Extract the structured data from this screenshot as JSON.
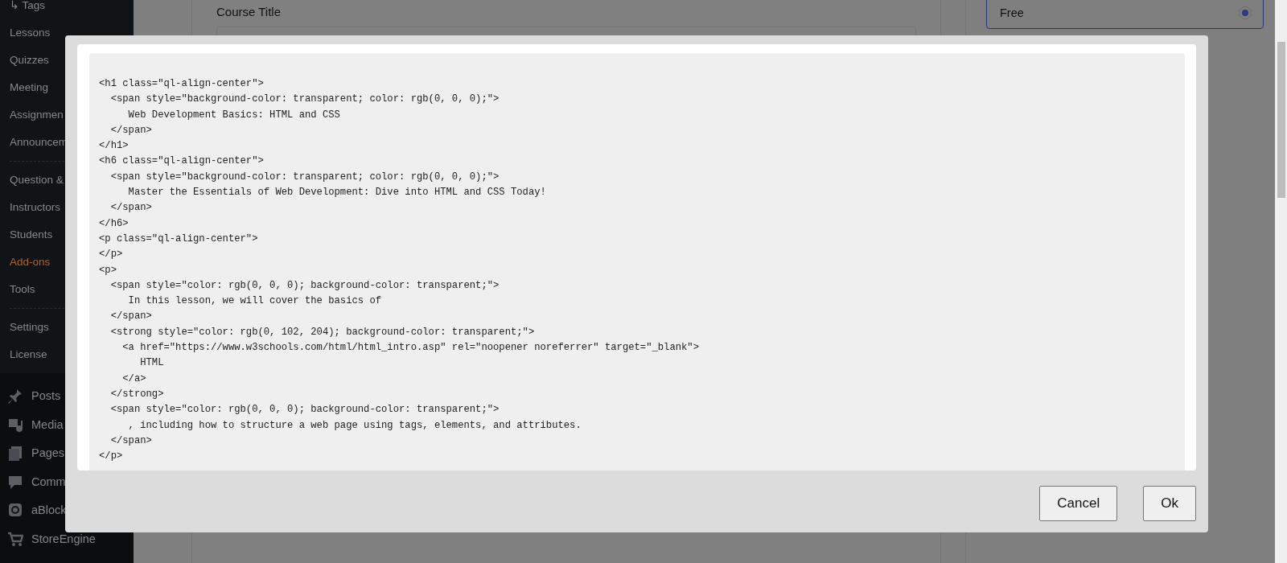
{
  "sidebar": {
    "submenu_groups": [
      [
        {
          "label": "↳ Tags",
          "selected": false
        },
        {
          "label": "Lessons",
          "selected": false
        },
        {
          "label": "Quizzes",
          "selected": false
        },
        {
          "label": "Meeting",
          "selected": false
        },
        {
          "label": "Assignmen",
          "selected": false
        },
        {
          "label": "Announcem",
          "selected": false
        }
      ],
      [
        {
          "label": "Question &",
          "selected": false
        },
        {
          "label": "Instructors",
          "selected": false
        },
        {
          "label": "Students",
          "selected": false
        },
        {
          "label": "Add-ons",
          "selected": true
        },
        {
          "label": "Tools",
          "selected": false
        }
      ],
      [
        {
          "label": "Settings",
          "selected": false
        },
        {
          "label": "License",
          "selected": false
        }
      ]
    ],
    "menu": [
      {
        "label": "Posts"
      },
      {
        "label": "Media"
      },
      {
        "label": "Pages"
      },
      {
        "label": "Comm"
      },
      {
        "label": "aBlock"
      },
      {
        "label": "StoreEngine"
      }
    ]
  },
  "editor": {
    "course_title_label": "Course Title"
  },
  "pricing": {
    "option": {
      "label": "Free",
      "selected": true
    }
  },
  "dialog": {
    "code_lines": [
      "<h1 class=\"ql-align-center\">",
      "  <span style=\"background-color: transparent; color: rgb(0, 0, 0);\">",
      "     Web Development Basics: HTML and CSS",
      "  </span>",
      "</h1>",
      "<h6 class=\"ql-align-center\">",
      "  <span style=\"background-color: transparent; color: rgb(0, 0, 0);\">",
      "     Master the Essentials of Web Development: Dive into HTML and CSS Today!",
      "  </span>",
      "</h6>",
      "<p class=\"ql-align-center\">",
      "</p>",
      "<p>",
      "  <span style=\"color: rgb(0, 0, 0); background-color: transparent;\">",
      "     In this lesson, we will cover the basics of",
      "  </span>",
      "  <strong style=\"color: rgb(0, 102, 204); background-color: transparent;\">",
      "    <a href=\"https://www.w3schools.com/html/html_intro.asp\" rel=\"noopener noreferrer\" target=\"_blank\">",
      "       HTML",
      "    </a>",
      "  </strong>",
      "  <span style=\"color: rgb(0, 0, 0); background-color: transparent;\">",
      "     , including how to structure a web page using tags, elements, and attributes.",
      "  </span>",
      "</p>"
    ],
    "buttons": [
      {
        "label": "Cancel"
      },
      {
        "label": "Ok"
      }
    ]
  }
}
